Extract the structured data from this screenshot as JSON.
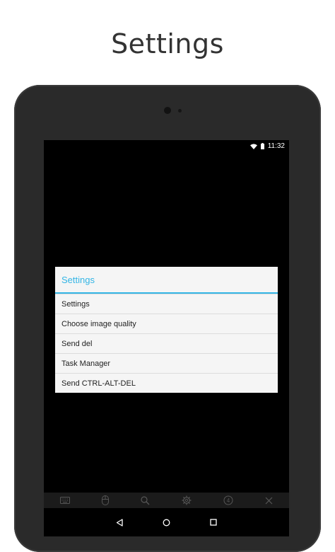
{
  "caption": "Settings",
  "status_bar": {
    "time": "11:32",
    "icons": [
      "wifi-icon",
      "battery-icon"
    ]
  },
  "dialog": {
    "title": "Settings",
    "items": [
      {
        "label": "Settings"
      },
      {
        "label": "Choose image quality"
      },
      {
        "label": "Send del"
      },
      {
        "label": "Task Manager"
      },
      {
        "label": "Send CTRL-ALT-DEL"
      }
    ]
  },
  "toolbar": {
    "icons": [
      "keyboard-icon",
      "mouse-icon",
      "search-icon",
      "gear-icon",
      "finger-count-icon",
      "close-icon"
    ],
    "finger_count": "4"
  },
  "navbar": {
    "icons": [
      "back-icon",
      "home-icon",
      "recents-icon"
    ]
  },
  "colors": {
    "accent": "#33b5e5",
    "dialog_bg": "#f5f5f5",
    "screen_bg": "#000000",
    "device_body": "#2a2a2a"
  }
}
